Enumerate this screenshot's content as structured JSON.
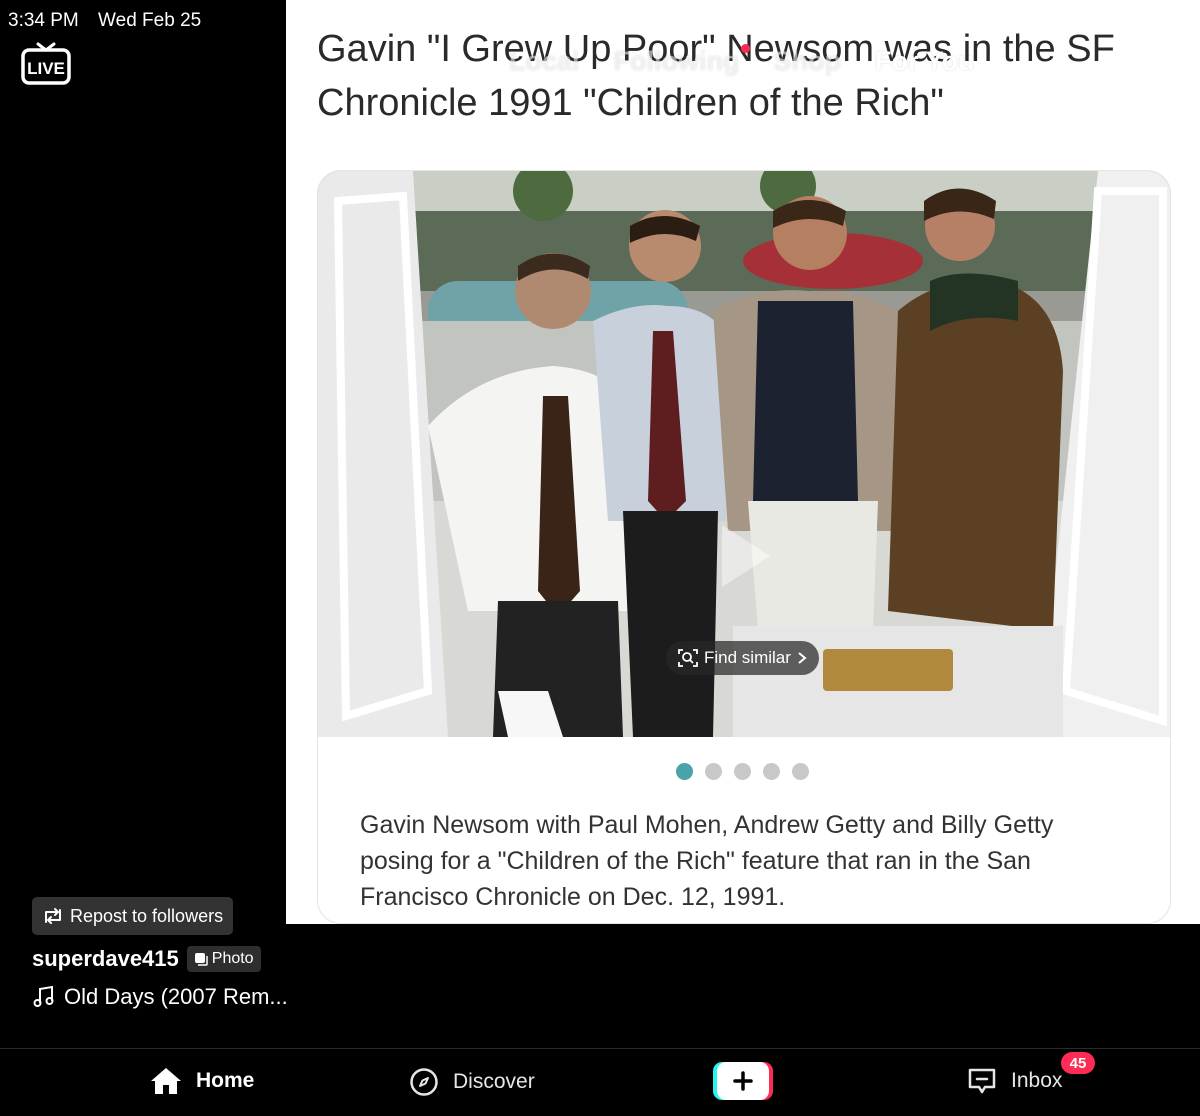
{
  "status_bar": {
    "time": "3:34 PM",
    "date": "Wed Feb 25"
  },
  "live": {
    "label": "LIVE"
  },
  "top_tabs": [
    {
      "label": "Local"
    },
    {
      "label": "Following"
    },
    {
      "label": "Shop"
    },
    {
      "label": "For You"
    }
  ],
  "post": {
    "headline": "Gavin \"I Grew Up Poor\" Newsom was in the SF Chronicle 1991 \"Children of the Rich\"",
    "find_similar": "Find similar",
    "caption": "Gavin Newsom with Paul Mohen, Andrew Getty and Billy Getty posing for a \"Children of the Rich\" feature that ran in the San Francisco Chronicle on Dec. 12, 1991.",
    "carousel": {
      "count": 5,
      "active_index": 1
    }
  },
  "repost": {
    "label": "Repost to followers"
  },
  "author": {
    "username": "superdave415",
    "badge": "Photo"
  },
  "music": {
    "title": "Old Days (2007 Rem..."
  },
  "bottom_nav": {
    "home": "Home",
    "discover": "Discover",
    "inbox": "Inbox",
    "inbox_badge": "45"
  },
  "colors": {
    "accent": "#fe2c55",
    "cyan": "#25f4ee",
    "carousel_active": "#4aa3a8"
  }
}
